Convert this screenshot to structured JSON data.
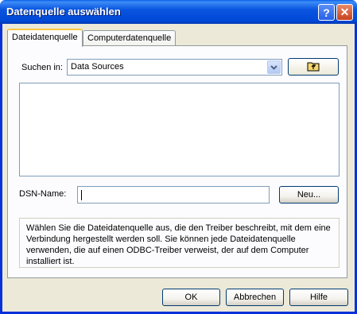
{
  "window": {
    "title": "Datenquelle auswählen",
    "help_label": "?",
    "close_label": "✕"
  },
  "tabs": [
    {
      "label": "Dateidatenquelle",
      "active": true
    },
    {
      "label": "Computerdatenquelle",
      "active": false
    }
  ],
  "lookin": {
    "label": "Suchen in:",
    "value": "Data Sources"
  },
  "dsn": {
    "label": "DSN-Name:",
    "value": "",
    "new_label": "Neu..."
  },
  "description": "Wählen Sie die Dateidatenquelle aus, die den Treiber beschreibt, mit dem eine Verbindung hergestellt werden soll. Sie können jede Dateidatenquelle verwenden, die auf einen ODBC-Treiber verweist, der auf dem Computer installiert ist.",
  "buttons": {
    "ok": "OK",
    "cancel": "Abbrechen",
    "help": "Hilfe"
  },
  "icons": {
    "up_folder": "folder-up-icon",
    "dropdown": "chevron-down-icon"
  }
}
